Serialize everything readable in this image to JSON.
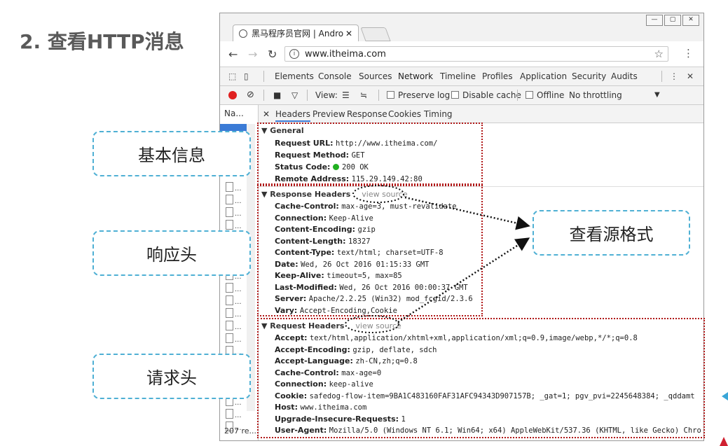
{
  "slide": {
    "title": "2.  查看HTTP消息"
  },
  "browser": {
    "window_controls": [
      "—",
      "▢",
      "✕"
    ],
    "tab_title": "黑马程序员官网 | Andro",
    "tab_close": "✕",
    "url": "www.itheima.com"
  },
  "devtools": {
    "tabs": [
      "Elements",
      "Console",
      "Sources",
      "Network",
      "Timeline",
      "Profiles",
      "Application",
      "Security",
      "Audits"
    ],
    "active_tab": "Network",
    "toolbar": {
      "view_label": "View:",
      "preserve_log": "Preserve log",
      "disable_cache": "Disable cache",
      "offline": "Offline",
      "throttling": "No throttling"
    },
    "name_col": "Na...",
    "row_label": "...",
    "footer": "207 re...",
    "detail_tabs": [
      "Headers",
      "Preview",
      "Response",
      "Cookies",
      "Timing"
    ],
    "detail_close": "✕"
  },
  "general": {
    "title": "▼ General",
    "rows": [
      {
        "k": "Request URL:",
        "v": "http://www.itheima.com/"
      },
      {
        "k": "Request Method:",
        "v": "GET"
      },
      {
        "k": "Status Code:",
        "v": "200 OK"
      },
      {
        "k": "Remote Address:",
        "v": "115.29.149.42:80"
      }
    ]
  },
  "response_headers": {
    "title": "▼ Response Headers",
    "view_source": "view source",
    "rows": [
      {
        "k": "Cache-Control:",
        "v": "max-age=3, must-revalidate"
      },
      {
        "k": "Connection:",
        "v": "Keep-Alive"
      },
      {
        "k": "Content-Encoding:",
        "v": "gzip"
      },
      {
        "k": "Content-Length:",
        "v": "18327"
      },
      {
        "k": "Content-Type:",
        "v": "text/html; charset=UTF-8"
      },
      {
        "k": "Date:",
        "v": "Wed, 26 Oct 2016 01:15:33 GMT"
      },
      {
        "k": "Keep-Alive:",
        "v": "timeout=5, max=85"
      },
      {
        "k": "Last-Modified:",
        "v": "Wed, 26 Oct 2016 00:00:37 GMT"
      },
      {
        "k": "Server:",
        "v": "Apache/2.2.25 (Win32) mod_fcgid/2.3.6"
      },
      {
        "k": "Vary:",
        "v": "Accept-Encoding,Cookie"
      }
    ]
  },
  "request_headers": {
    "title": "▼ Request Headers",
    "view_source": "view source",
    "rows": [
      {
        "k": "Accept:",
        "v": "text/html,application/xhtml+xml,application/xml;q=0.9,image/webp,*/*;q=0.8"
      },
      {
        "k": "Accept-Encoding:",
        "v": "gzip, deflate, sdch"
      },
      {
        "k": "Accept-Language:",
        "v": "zh-CN,zh;q=0.8"
      },
      {
        "k": "Cache-Control:",
        "v": "max-age=0"
      },
      {
        "k": "Connection:",
        "v": "keep-alive"
      },
      {
        "k": "Cookie:",
        "v": "safedog-flow-item=9BA1C483160FAF31AFC94343D907157B; _gat=1; pgv_pvi=2245648384; _qddamt"
      },
      {
        "k": "Host:",
        "v": "www.itheima.com"
      },
      {
        "k": "Upgrade-Insecure-Requests:",
        "v": "1"
      },
      {
        "k": "User-Agent:",
        "v": "Mozilla/5.0 (Windows NT 6.1; Win64; x64) AppleWebKit/537.36 (KHTML, like Gecko) Chro"
      }
    ]
  },
  "callouts": {
    "general": "基本信息",
    "response": "响应头",
    "request": "请求头",
    "view_source": "查看源格式"
  },
  "colors": {
    "callout_border": "#4fb0d4",
    "highlight_box": "#b01818",
    "selection": "#3b7bd6"
  },
  "icons": [
    "back-arrow-icon",
    "forward-arrow-icon",
    "reload-icon",
    "info-icon",
    "star-icon",
    "kebab-menu-icon",
    "inspect-icon",
    "device-icon",
    "record-icon",
    "clear-icon",
    "camera-icon",
    "filter-icon",
    "list-view-icon",
    "waterfall-icon",
    "dropdown-arrow-icon",
    "file-icon"
  ]
}
